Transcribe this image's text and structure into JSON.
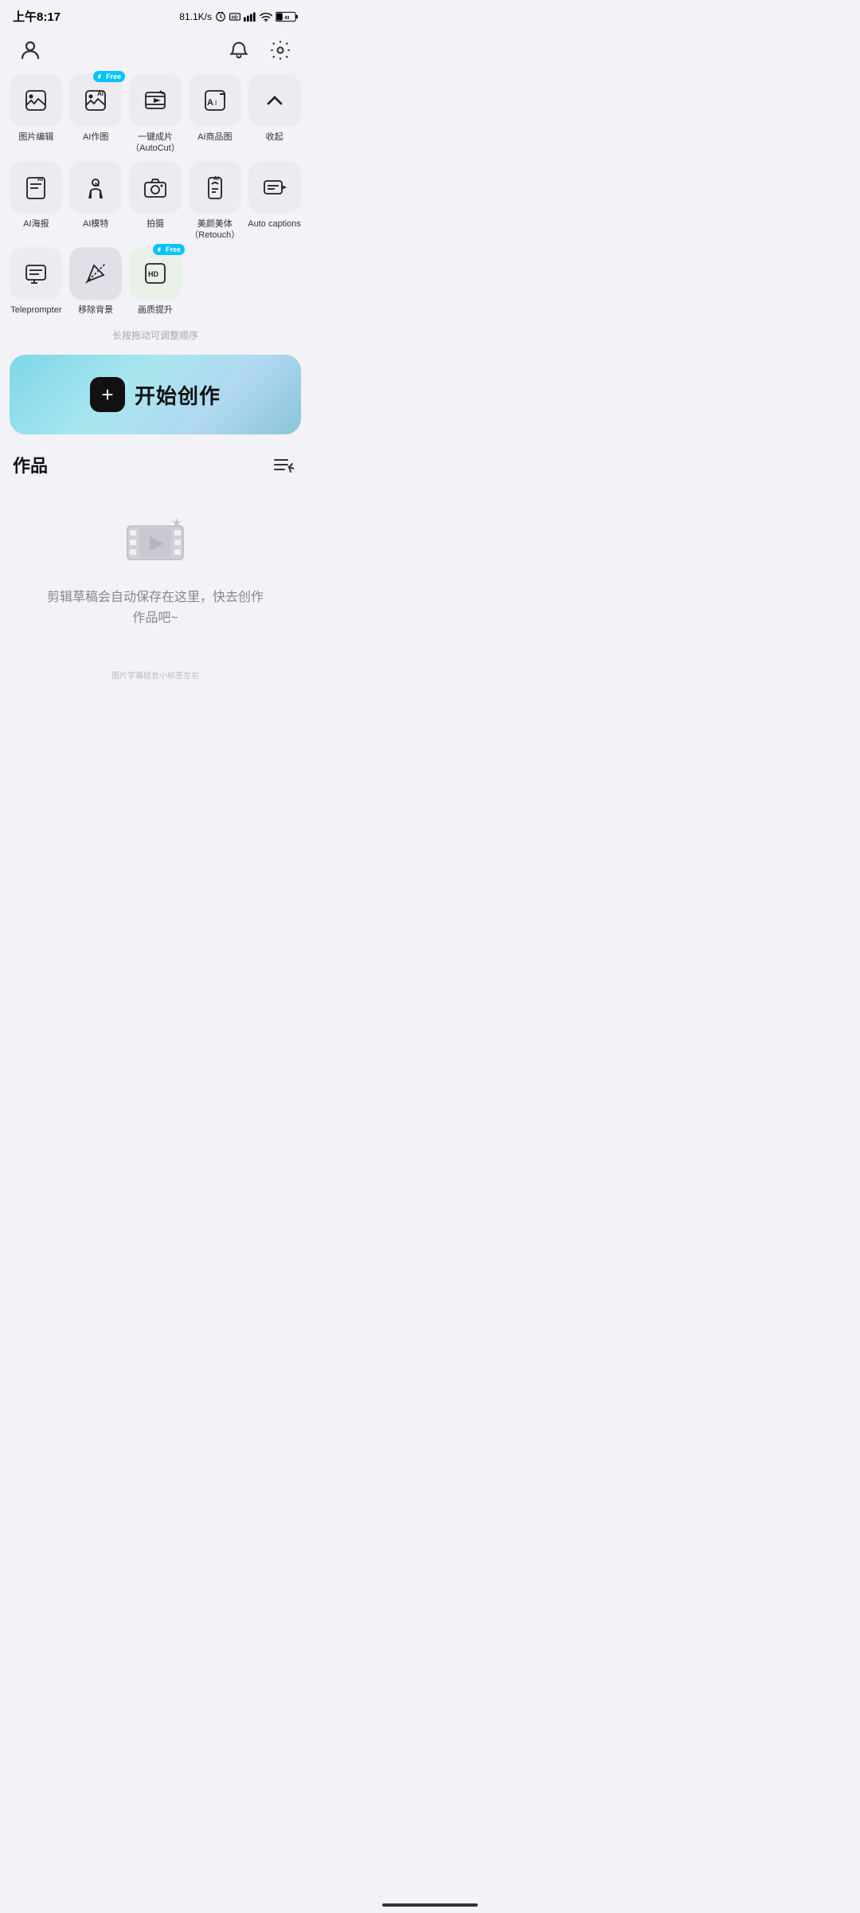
{
  "statusBar": {
    "time": "上午8:17",
    "speed": "81.1K/s",
    "battery": "43"
  },
  "header": {
    "userIconName": "user-icon",
    "bellIconName": "bell-icon",
    "settingsIconName": "settings-icon"
  },
  "toolsRow1": [
    {
      "id": "img-edit",
      "label": "图片编辑",
      "icon": "img-edit-icon",
      "badge": null
    },
    {
      "id": "ai-draw",
      "label": "AI作图",
      "icon": "ai-draw-icon",
      "badge": "Free"
    },
    {
      "id": "autocut",
      "label": "一键成片\n（AutoCut）",
      "icon": "autocut-icon",
      "badge": null
    },
    {
      "id": "ai-product",
      "label": "AI商品图",
      "icon": "ai-product-icon",
      "badge": null
    },
    {
      "id": "collapse",
      "label": "收起",
      "icon": "collapse-icon",
      "badge": null
    }
  ],
  "toolsRow2": [
    {
      "id": "ai-poster",
      "label": "AI海报",
      "icon": "ai-poster-icon",
      "badge": null
    },
    {
      "id": "ai-model",
      "label": "AI模特",
      "icon": "ai-model-icon",
      "badge": null
    },
    {
      "id": "camera",
      "label": "拍摄",
      "icon": "camera-icon",
      "badge": null
    },
    {
      "id": "retouch",
      "label": "美颜美体\n（Retouch）",
      "icon": "retouch-icon",
      "badge": null
    },
    {
      "id": "autocaptions",
      "label": "Auto captions",
      "icon": "autocaptions-icon",
      "badge": null
    }
  ],
  "toolsRow3": [
    {
      "id": "teleprompter",
      "label": "Teleprompter",
      "icon": "teleprompter-icon",
      "badge": null
    },
    {
      "id": "remove-bg",
      "label": "移除背景",
      "icon": "remove-bg-icon",
      "badge": null
    },
    {
      "id": "enhance",
      "label": "画质提升",
      "icon": "enhance-icon",
      "badge": "Free"
    }
  ],
  "dragHint": "长按拖动可调整顺序",
  "createBtn": {
    "plusLabel": "+",
    "text": "开始创作"
  },
  "worksSection": {
    "title": "作品",
    "menuIconName": "sort-edit-icon"
  },
  "emptyState": {
    "iconName": "film-reel-icon",
    "text": "剪辑草稿会自动保存在这里，快去创作\n作品吧~"
  },
  "watermark": "图片字幕结合小标签左右"
}
